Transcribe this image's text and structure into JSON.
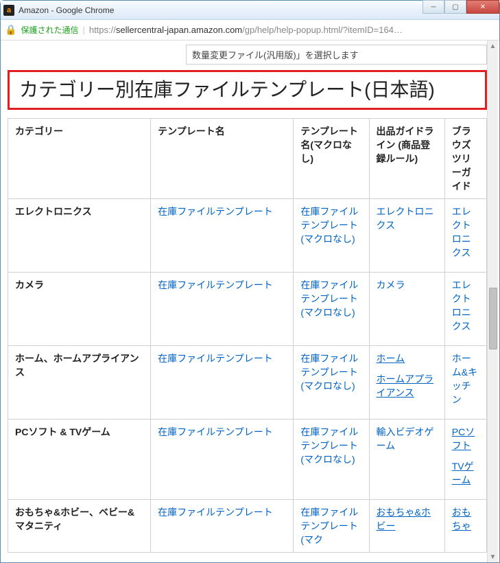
{
  "window": {
    "title": "Amazon - Google Chrome",
    "favicon_text": "a"
  },
  "address": {
    "secure_label": "保護された通信",
    "url_prefix": "https://",
    "url_host": "sellercentral-japan.amazon.com",
    "url_path": "/gp/help/help-popup.html/?itemID=164…"
  },
  "partial_top_text": "数量変更ファイル(汎用版)」を選択します",
  "heading": "カテゴリー別在庫ファイルテンプレート(日本語)",
  "headers": {
    "category": "カテゴリー",
    "template": "テンプレート名",
    "template_nomacro": "テンプレート名(マクロなし)",
    "guideline": "出品ガイドライン (商品登録ルール)",
    "browse": "ブラウズツリーガイド"
  },
  "rows": [
    {
      "category": "エレクトロニクス",
      "template": "在庫ファイルテンプレート",
      "template_nomacro": "在庫ファイルテンプレート(マクロなし)",
      "guideline": [
        "エレクトロニクス"
      ],
      "guideline_ul": [
        false
      ],
      "browse": [
        "エレクトロニクス"
      ],
      "browse_ul": [
        false
      ]
    },
    {
      "category": "カメラ",
      "template": "在庫ファイルテンプレート",
      "template_nomacro": "在庫ファイルテンプレート(マクロなし)",
      "guideline": [
        "カメラ"
      ],
      "guideline_ul": [
        false
      ],
      "browse": [
        "エレクトロニクス"
      ],
      "browse_ul": [
        false
      ]
    },
    {
      "category": "ホーム、ホームアプライアンス",
      "template": "在庫ファイルテンプレート",
      "template_nomacro": "在庫ファイルテンプレート(マクロなし)",
      "guideline": [
        "ホーム",
        "ホームアプライアンス"
      ],
      "guideline_ul": [
        true,
        true
      ],
      "browse": [
        "ホーム&キッチン"
      ],
      "browse_ul": [
        false
      ]
    },
    {
      "category": "PCソフト & TVゲーム",
      "template": "在庫ファイルテンプレート",
      "template_nomacro": "在庫ファイルテンプレート(マクロなし)",
      "guideline": [
        "輸入ビデオゲーム"
      ],
      "guideline_ul": [
        false
      ],
      "browse": [
        "PCソフト",
        "TVゲーム"
      ],
      "browse_ul": [
        true,
        true
      ]
    },
    {
      "category": "おもちゃ&ホビー、ベビー&マタニティ",
      "template": "在庫ファイルテンプレート",
      "template_nomacro": "在庫ファイルテンプレート(マク",
      "guideline": [
        "おもちゃ&ホビー"
      ],
      "guideline_ul": [
        true
      ],
      "browse": [
        "おもちゃ"
      ],
      "browse_ul": [
        true
      ]
    }
  ]
}
